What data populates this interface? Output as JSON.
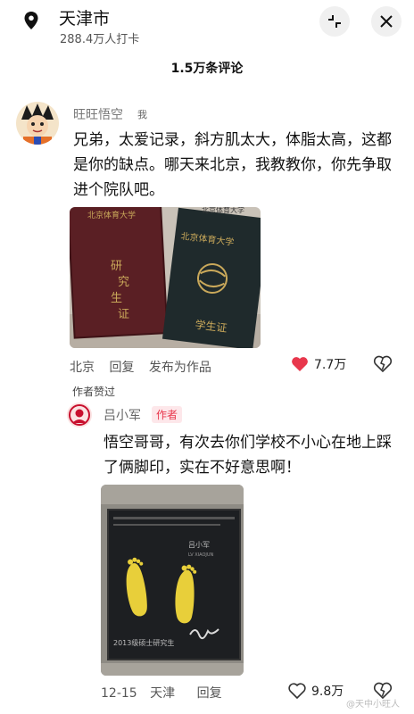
{
  "header": {
    "location_icon": "location-pin-icon",
    "city": "天津市",
    "checkins": "288.4万人打卡",
    "collapse_icon": "collapse-icon",
    "close_icon": "close-icon"
  },
  "comments_count": "1.5万条评论",
  "comment": {
    "username": "旺旺悟空",
    "me_tag": "我",
    "text": "兄弟，太爱记录，斜方肌太大，体脂太高，这都是你的缺点。哪天来北京，我教教你，你先争取进个院队吧。",
    "photo": {
      "cover_left_lines": [
        "研",
        "究",
        "生",
        "证"
      ],
      "cover_top_left": "北京体育大学",
      "cover_top_right": "北京体育大学",
      "cover_right_title": "北京体育大学",
      "cover_right_bottom": "学生证"
    },
    "location": "北京",
    "reply": "回复",
    "publish": "发布为作品",
    "likes": "7.7万",
    "colors": {
      "like": "#e8374c"
    }
  },
  "liked_by_author": "作者赞过",
  "reply_comment": {
    "username": "吕小军",
    "author_tag": "作者",
    "text": "悟空哥哥，有次去你们学校不小心在地上踩了俩脚印，实在不好意思啊！",
    "photo": {
      "plaque_name": "吕小军",
      "plaque_name_en": "LV XIAOJUN",
      "plaque_bottom": "2013级硕士研究生"
    },
    "date": "12-15",
    "location": "天津",
    "reply": "回复",
    "likes": "9.8万"
  },
  "watermark": "@天中小旺人"
}
